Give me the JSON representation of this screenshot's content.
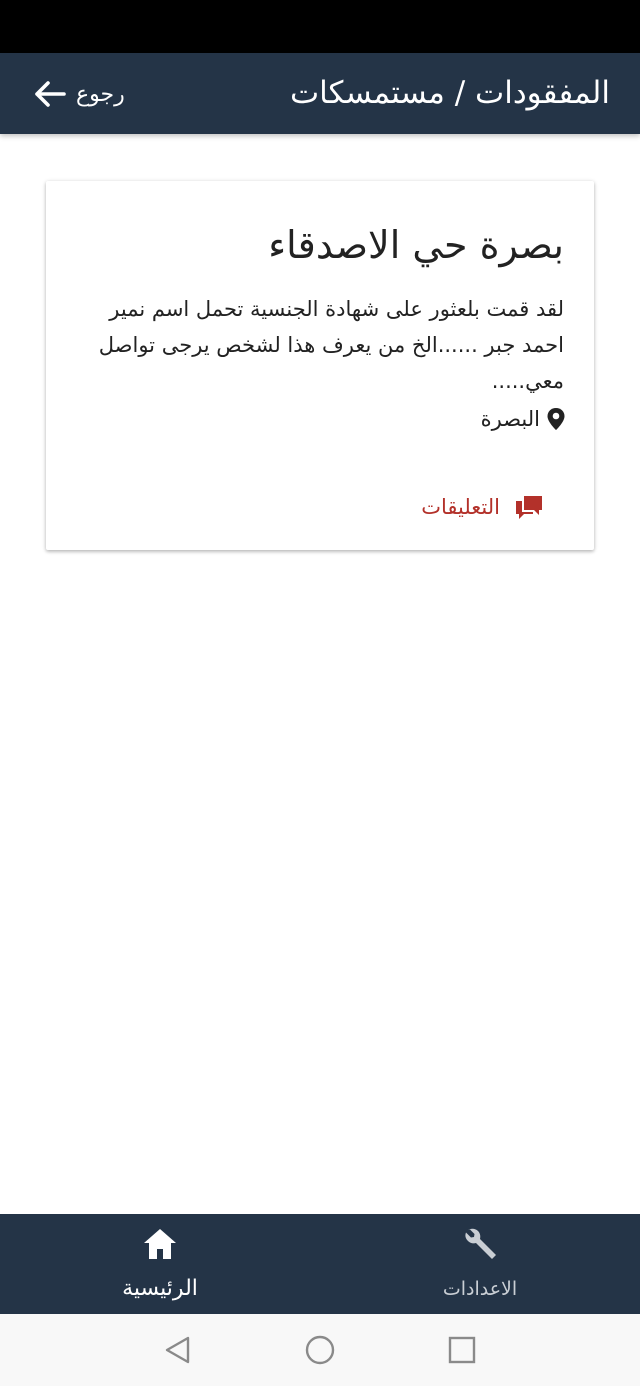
{
  "app_bar": {
    "title": "المفقودات / مستمسكات",
    "back_label": "رجوع",
    "back_icon": "arrow-left-icon",
    "background": "#243447"
  },
  "post": {
    "title": "بصرة حي الاصدقاء",
    "body": "لقد قمت بلعثور على شهادة الجنسية تحمل اسم نمير احمد جبر ......الخ من يعرف هذا لشخص يرجى تواصل معي.....",
    "location_icon": "map-pin-icon",
    "location": "البصرة",
    "comments_label": "التعليقات",
    "comments_icon": "comment-icon",
    "accent": "#b3312a"
  },
  "bottom_nav": {
    "items": [
      {
        "label": "الرئيسية",
        "icon": "home-icon",
        "active": true
      },
      {
        "label": "الاعدادات",
        "icon": "wrench-icon",
        "active": false
      }
    ]
  },
  "system_nav": {
    "buttons": [
      "back-triangle-icon",
      "home-circle-icon",
      "recent-square-icon"
    ]
  }
}
